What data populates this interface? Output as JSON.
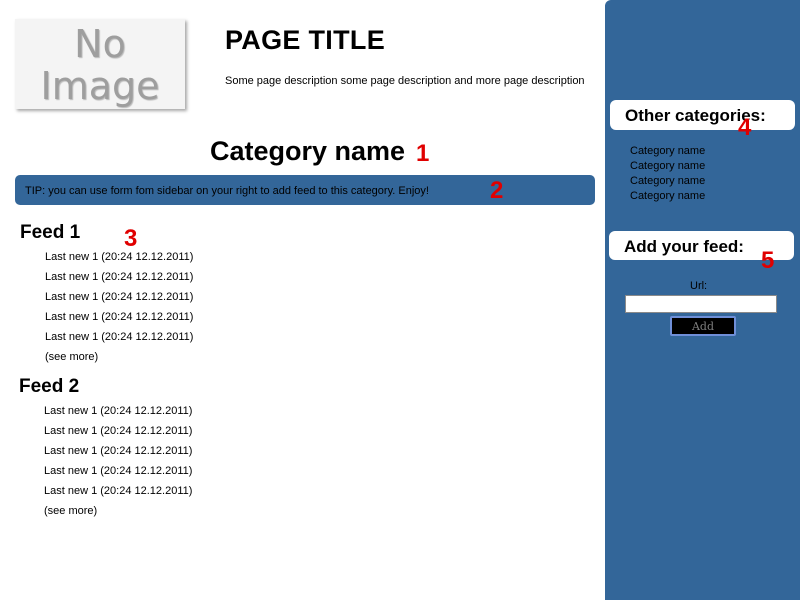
{
  "header": {
    "logo_placeholder_lines": [
      "No",
      "Image"
    ],
    "title": "PAGE TITLE",
    "description": "Some page description some page description and more page description"
  },
  "category": {
    "name": "Category name",
    "tip": "TIP: you can use form fom sidebar on your right to add feed to this category. Enjoy!"
  },
  "markers": [
    "1",
    "2",
    "3",
    "4",
    "5"
  ],
  "feeds": [
    {
      "title": "Feed 1",
      "items": [
        "Last new 1 (20:24 12.12.2011)",
        "Last new 1 (20:24 12.12.2011)",
        "Last new 1 (20:24 12.12.2011)",
        "Last new 1 (20:24 12.12.2011)",
        "Last new 1 (20:24 12.12.2011)"
      ],
      "see_more": "(see more)"
    },
    {
      "title": "Feed 2",
      "items": [
        "Last new 1 (20:24 12.12.2011)",
        "Last new 1 (20:24 12.12.2011)",
        "Last new 1 (20:24 12.12.2011)",
        "Last new 1 (20:24 12.12.2011)",
        "Last new 1 (20:24 12.12.2011)"
      ],
      "see_more": "(see more)"
    }
  ],
  "sidebar": {
    "other_categories_title": "Other categories:",
    "categories": [
      "Category name",
      "Category name",
      "Category name",
      "Category name"
    ],
    "add_feed_title": "Add your feed:",
    "url_label": "Url:",
    "url_value": "",
    "add_button": "Add"
  },
  "colors": {
    "accent_blue": "#336699",
    "marker_red": "#e00000",
    "placeholder_gray": "#9e9e9e"
  }
}
